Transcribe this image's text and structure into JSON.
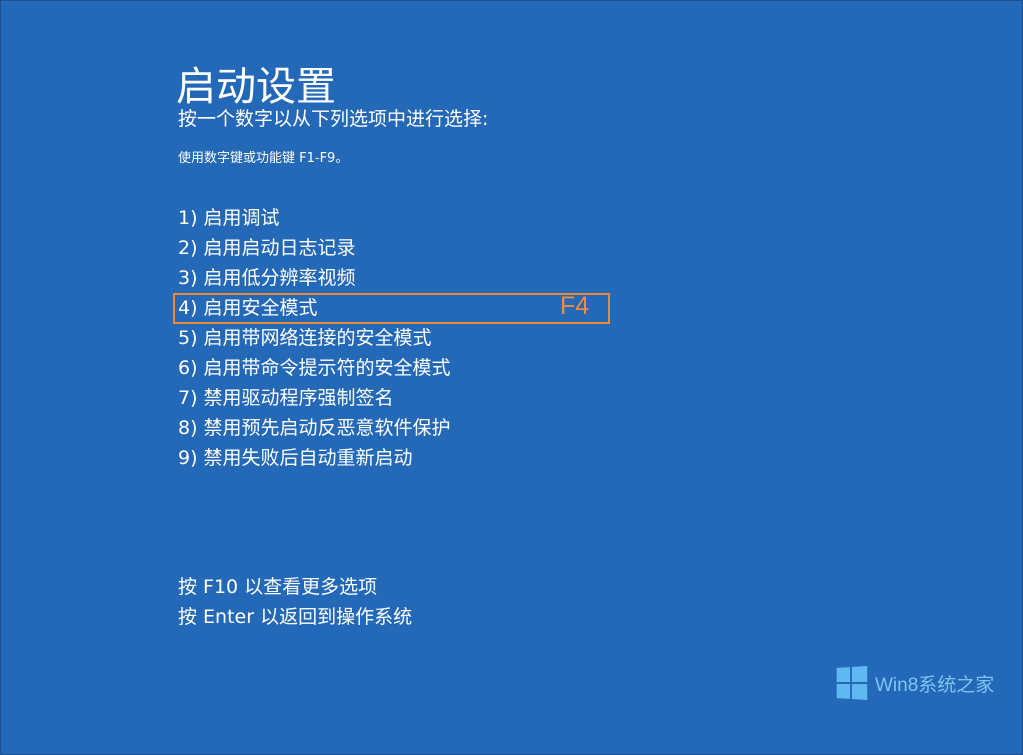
{
  "screen": {
    "title": "启动设置",
    "instruction": "按一个数字以从下列选项中进行选择:",
    "hint": "使用数字键或功能键 F1-F9。"
  },
  "options": [
    {
      "label": "1) 启用调试"
    },
    {
      "label": "2) 启用启动日志记录"
    },
    {
      "label": "3) 启用低分辨率视频"
    },
    {
      "label": "4) 启用安全模式"
    },
    {
      "label": "5) 启用带网络连接的安全模式"
    },
    {
      "label": "6) 启用带命令提示符的安全模式"
    },
    {
      "label": "7) 禁用驱动程序强制签名"
    },
    {
      "label": "8) 禁用预先启动反恶意软件保护"
    },
    {
      "label": "9) 禁用失败后自动重新启动"
    }
  ],
  "annotation": {
    "key_label": "F4",
    "color": "#e88a3c"
  },
  "footer": {
    "more_options": "按 F10 以查看更多选项",
    "return": "按 Enter 以返回到操作系统"
  },
  "watermark": {
    "icon": "windows-logo-icon",
    "text": "Win8系统之家"
  },
  "colors": {
    "background": "#2468b8",
    "text": "#ffffff",
    "watermark": "#7cc6f4"
  }
}
